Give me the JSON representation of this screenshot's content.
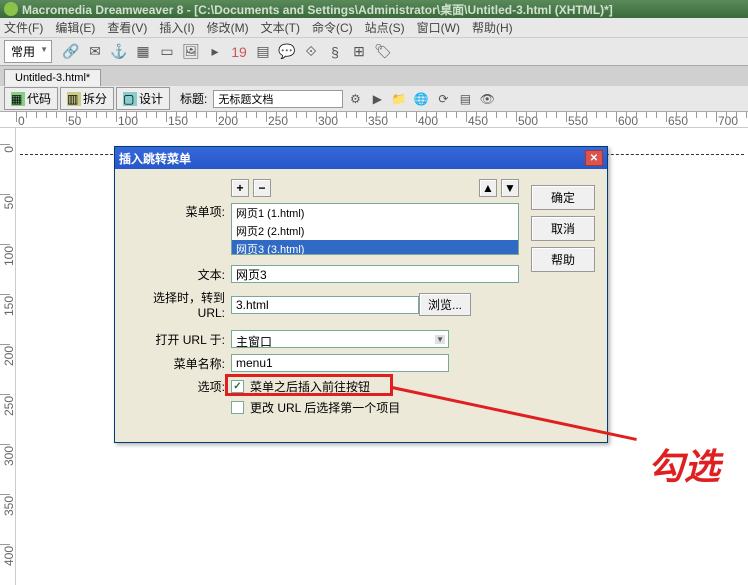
{
  "titlebar": {
    "app": "Macromedia Dreamweaver 8",
    "path": "[C:\\Documents and Settings\\Administrator\\桌面\\Untitled-3.html (XHTML)*]"
  },
  "menubar": {
    "file": "文件(F)",
    "edit": "编辑(E)",
    "view": "查看(V)",
    "insert": "插入(I)",
    "modify": "修改(M)",
    "text": "文本(T)",
    "commands": "命令(C)",
    "site": "站点(S)",
    "window": "窗口(W)",
    "help": "帮助(H)"
  },
  "toolbar": {
    "category": "常用"
  },
  "tab": {
    "name": "Untitled-3.html*"
  },
  "doctoolbar": {
    "code": "代码",
    "split": "拆分",
    "design": "设计",
    "title_label": "标题:",
    "title_value": "无标题文档"
  },
  "dialog": {
    "title": "插入跳转菜单",
    "buttons": {
      "ok": "确定",
      "cancel": "取消",
      "help": "帮助"
    },
    "labels": {
      "menu_items": "菜单项:",
      "text": "文本:",
      "url": "选择时，转到 URL:",
      "open_in": "打开 URL 于:",
      "menu_name": "菜单名称:",
      "options": "选项:"
    },
    "add": "+",
    "remove": "−",
    "up": "▲",
    "down": "▼",
    "items": [
      {
        "label": "网页1 (1.html)",
        "selected": false
      },
      {
        "label": "网页2 (2.html)",
        "selected": false
      },
      {
        "label": "网页3 (3.html)",
        "selected": true
      }
    ],
    "text_value": "网页3",
    "url_value": "3.html",
    "browse": "浏览...",
    "open_in_value": "主窗口",
    "menu_name_value": "menu1",
    "option1": "菜单之后插入前往按钮",
    "option1_checked": true,
    "option2": "更改 URL 后选择第一个项目",
    "option2_checked": false
  },
  "annotation": {
    "text": "勾选"
  },
  "ruler_ticks": [
    0,
    50,
    100,
    150,
    200,
    250,
    300,
    350,
    400,
    450,
    500,
    550,
    600,
    650,
    700
  ]
}
